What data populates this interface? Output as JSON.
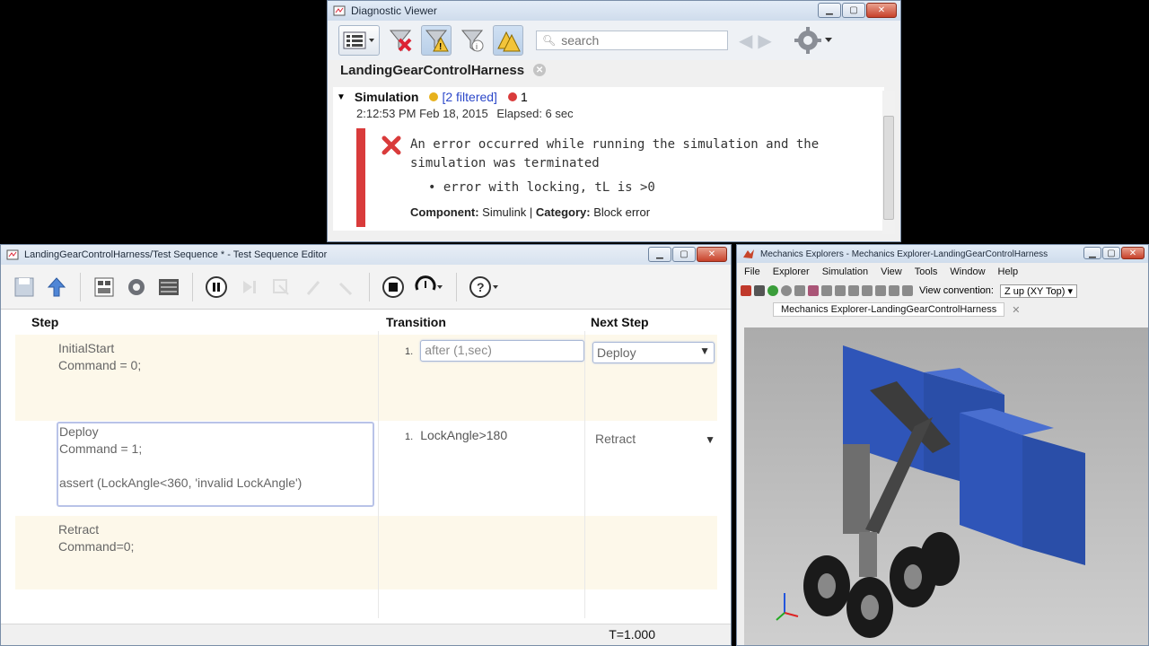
{
  "diagnostic_viewer": {
    "title": "Diagnostic Viewer",
    "search_placeholder": "search",
    "tab": "LandingGearControlHarness",
    "section": "Simulation",
    "filtered": "[2 filtered]",
    "error_count": "1",
    "timestamp": "2:12:53 PM Feb 18, 2015",
    "elapsed": "Elapsed: 6 sec",
    "error_message": "An error occurred while running the simulation and the simulation was terminated",
    "error_detail": "error with locking, tL is >0",
    "component_label": "Component:",
    "component_value": "Simulink",
    "category_label": "Category:",
    "category_value": "Block error",
    "colors": {
      "error": "#d93b3b",
      "warning": "#e7b11c",
      "link": "#2b47c9"
    }
  },
  "test_sequence_editor": {
    "title": "LandingGearControlHarness/Test Sequence * - Test Sequence Editor",
    "headers": {
      "step": "Step",
      "transition": "Transition",
      "next_step": "Next Step"
    },
    "rows": [
      {
        "step": "InitialStart\nCommand = 0;",
        "transition_num": "1.",
        "transition": "after (1,sec)",
        "next_step": "Deploy"
      },
      {
        "step": "Deploy\nCommand = 1;\n\nassert (LockAngle<360, 'invalid LockAngle')",
        "transition_num": "1.",
        "transition": "LockAngle>180",
        "next_step": "Retract"
      },
      {
        "step": "Retract\nCommand=0;",
        "transition_num": "",
        "transition": "",
        "next_step": ""
      }
    ],
    "status_time": "T=1.000"
  },
  "mechanics_explorer": {
    "title": "Mechanics Explorers - Mechanics Explorer-LandingGearControlHarness",
    "menu": [
      "File",
      "Explorer",
      "Simulation",
      "View",
      "Tools",
      "Window",
      "Help"
    ],
    "view_convention_label": "View convention:",
    "view_convention_value": "Z up (XY Top)",
    "tab": "Mechanics Explorer-LandingGearControlHarness"
  }
}
